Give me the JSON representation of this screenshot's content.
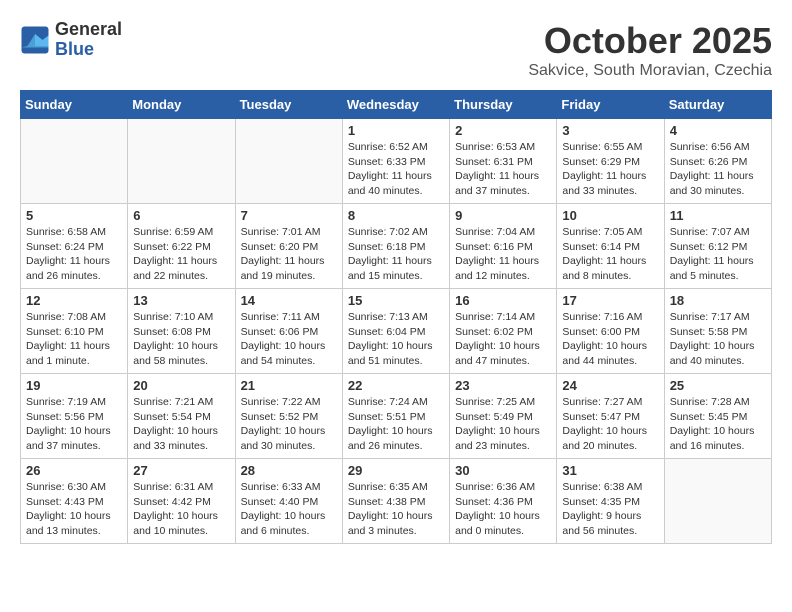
{
  "header": {
    "logo_general": "General",
    "logo_blue": "Blue",
    "month_title": "October 2025",
    "subtitle": "Sakvice, South Moravian, Czechia"
  },
  "days_of_week": [
    "Sunday",
    "Monday",
    "Tuesday",
    "Wednesday",
    "Thursday",
    "Friday",
    "Saturday"
  ],
  "weeks": [
    [
      {
        "day": "",
        "info": ""
      },
      {
        "day": "",
        "info": ""
      },
      {
        "day": "",
        "info": ""
      },
      {
        "day": "1",
        "info": "Sunrise: 6:52 AM\nSunset: 6:33 PM\nDaylight: 11 hours and 40 minutes."
      },
      {
        "day": "2",
        "info": "Sunrise: 6:53 AM\nSunset: 6:31 PM\nDaylight: 11 hours and 37 minutes."
      },
      {
        "day": "3",
        "info": "Sunrise: 6:55 AM\nSunset: 6:29 PM\nDaylight: 11 hours and 33 minutes."
      },
      {
        "day": "4",
        "info": "Sunrise: 6:56 AM\nSunset: 6:26 PM\nDaylight: 11 hours and 30 minutes."
      }
    ],
    [
      {
        "day": "5",
        "info": "Sunrise: 6:58 AM\nSunset: 6:24 PM\nDaylight: 11 hours and 26 minutes."
      },
      {
        "day": "6",
        "info": "Sunrise: 6:59 AM\nSunset: 6:22 PM\nDaylight: 11 hours and 22 minutes."
      },
      {
        "day": "7",
        "info": "Sunrise: 7:01 AM\nSunset: 6:20 PM\nDaylight: 11 hours and 19 minutes."
      },
      {
        "day": "8",
        "info": "Sunrise: 7:02 AM\nSunset: 6:18 PM\nDaylight: 11 hours and 15 minutes."
      },
      {
        "day": "9",
        "info": "Sunrise: 7:04 AM\nSunset: 6:16 PM\nDaylight: 11 hours and 12 minutes."
      },
      {
        "day": "10",
        "info": "Sunrise: 7:05 AM\nSunset: 6:14 PM\nDaylight: 11 hours and 8 minutes."
      },
      {
        "day": "11",
        "info": "Sunrise: 7:07 AM\nSunset: 6:12 PM\nDaylight: 11 hours and 5 minutes."
      }
    ],
    [
      {
        "day": "12",
        "info": "Sunrise: 7:08 AM\nSunset: 6:10 PM\nDaylight: 11 hours and 1 minute."
      },
      {
        "day": "13",
        "info": "Sunrise: 7:10 AM\nSunset: 6:08 PM\nDaylight: 10 hours and 58 minutes."
      },
      {
        "day": "14",
        "info": "Sunrise: 7:11 AM\nSunset: 6:06 PM\nDaylight: 10 hours and 54 minutes."
      },
      {
        "day": "15",
        "info": "Sunrise: 7:13 AM\nSunset: 6:04 PM\nDaylight: 10 hours and 51 minutes."
      },
      {
        "day": "16",
        "info": "Sunrise: 7:14 AM\nSunset: 6:02 PM\nDaylight: 10 hours and 47 minutes."
      },
      {
        "day": "17",
        "info": "Sunrise: 7:16 AM\nSunset: 6:00 PM\nDaylight: 10 hours and 44 minutes."
      },
      {
        "day": "18",
        "info": "Sunrise: 7:17 AM\nSunset: 5:58 PM\nDaylight: 10 hours and 40 minutes."
      }
    ],
    [
      {
        "day": "19",
        "info": "Sunrise: 7:19 AM\nSunset: 5:56 PM\nDaylight: 10 hours and 37 minutes."
      },
      {
        "day": "20",
        "info": "Sunrise: 7:21 AM\nSunset: 5:54 PM\nDaylight: 10 hours and 33 minutes."
      },
      {
        "day": "21",
        "info": "Sunrise: 7:22 AM\nSunset: 5:52 PM\nDaylight: 10 hours and 30 minutes."
      },
      {
        "day": "22",
        "info": "Sunrise: 7:24 AM\nSunset: 5:51 PM\nDaylight: 10 hours and 26 minutes."
      },
      {
        "day": "23",
        "info": "Sunrise: 7:25 AM\nSunset: 5:49 PM\nDaylight: 10 hours and 23 minutes."
      },
      {
        "day": "24",
        "info": "Sunrise: 7:27 AM\nSunset: 5:47 PM\nDaylight: 10 hours and 20 minutes."
      },
      {
        "day": "25",
        "info": "Sunrise: 7:28 AM\nSunset: 5:45 PM\nDaylight: 10 hours and 16 minutes."
      }
    ],
    [
      {
        "day": "26",
        "info": "Sunrise: 6:30 AM\nSunset: 4:43 PM\nDaylight: 10 hours and 13 minutes."
      },
      {
        "day": "27",
        "info": "Sunrise: 6:31 AM\nSunset: 4:42 PM\nDaylight: 10 hours and 10 minutes."
      },
      {
        "day": "28",
        "info": "Sunrise: 6:33 AM\nSunset: 4:40 PM\nDaylight: 10 hours and 6 minutes."
      },
      {
        "day": "29",
        "info": "Sunrise: 6:35 AM\nSunset: 4:38 PM\nDaylight: 10 hours and 3 minutes."
      },
      {
        "day": "30",
        "info": "Sunrise: 6:36 AM\nSunset: 4:36 PM\nDaylight: 10 hours and 0 minutes."
      },
      {
        "day": "31",
        "info": "Sunrise: 6:38 AM\nSunset: 4:35 PM\nDaylight: 9 hours and 56 minutes."
      },
      {
        "day": "",
        "info": ""
      }
    ]
  ]
}
